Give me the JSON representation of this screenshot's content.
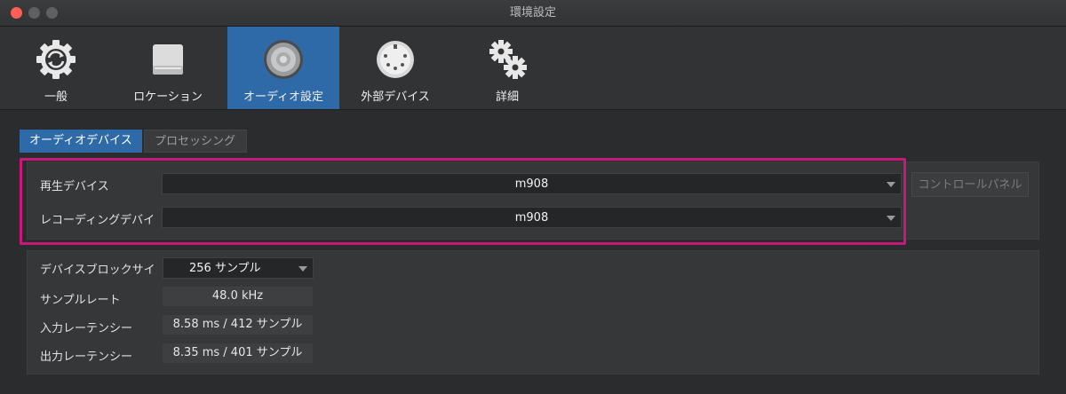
{
  "window": {
    "title": "環境設定"
  },
  "toolbar": {
    "items": [
      {
        "label": "一般",
        "icon": "gear-refresh-icon"
      },
      {
        "label": "ロケーション",
        "icon": "drive-icon"
      },
      {
        "label": "オーディオ設定",
        "icon": "speaker-icon"
      },
      {
        "label": "外部デバイス",
        "icon": "midi-port-icon"
      },
      {
        "label": "詳細",
        "icon": "gears-icon"
      }
    ],
    "active_index": 2
  },
  "tabs": [
    {
      "label": "オーディオデバイス",
      "active": true
    },
    {
      "label": "プロセッシング",
      "active": false
    }
  ],
  "devices": {
    "playback_label": "再生デバイス",
    "playback_value": "m908",
    "recording_label": "レコーディングデバイ",
    "recording_value": "m908",
    "control_panel_label": "コントロールパネル"
  },
  "settings": {
    "block_size_label": "デバイスブロックサイ",
    "block_size_value": "256 サンプル",
    "sample_rate_label": "サンプルレート",
    "sample_rate_value": "48.0 kHz",
    "input_latency_label": "入力レーテンシー",
    "input_latency_value": "8.58 ms / 412 サンプル",
    "output_latency_label": "出力レーテンシー",
    "output_latency_value": "8.35 ms / 401 サンプル"
  },
  "colors": {
    "accent": "#2f6aa8",
    "highlight": "#c8197a",
    "close": "#fd5f57"
  }
}
